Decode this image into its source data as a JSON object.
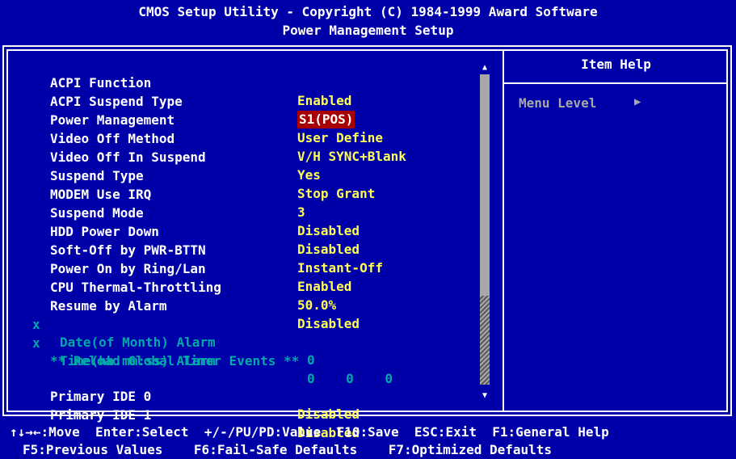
{
  "header": {
    "line1": "CMOS Setup Utility - Copyright (C) 1984-1999 Award Software",
    "line2": "Power Management Setup"
  },
  "settings": [
    {
      "label": "ACPI Function",
      "value": "Enabled"
    },
    {
      "label": "ACPI Suspend Type",
      "value": "S1(POS)"
    },
    {
      "label": "Power Management",
      "value": "User Define"
    },
    {
      "label": "Video Off Method",
      "value": "V/H SYNC+Blank"
    },
    {
      "label": "Video Off In Suspend",
      "value": "Yes"
    },
    {
      "label": "Suspend Type",
      "value": "Stop Grant"
    },
    {
      "label": "MODEM Use IRQ",
      "value": "3"
    },
    {
      "label": "Suspend Mode",
      "value": "Disabled"
    },
    {
      "label": "HDD Power Down",
      "value": "Disabled"
    },
    {
      "label": "Soft-Off by PWR-BTTN",
      "value": "Instant-Off"
    },
    {
      "label": "Power On by Ring/Lan",
      "value": "Enabled"
    },
    {
      "label": "CPU Thermal-Throttling",
      "value": "50.0%"
    },
    {
      "label": "Resume by Alarm",
      "value": "Disabled"
    },
    {
      "mark": "x",
      "label": "Date(of Month) Alarm",
      "value": "0"
    },
    {
      "mark": "x",
      "label": "Time(hh:mm:ss) Alarm",
      "value": "0    0    0"
    },
    {
      "section": "** Reload Global Timer Events **"
    },
    {
      "label": "Primary IDE 0",
      "value": "Disabled"
    },
    {
      "label": "Primary IDE 1",
      "value": "Disabled"
    }
  ],
  "scrollbar": {
    "up": "▲",
    "down": "▼"
  },
  "help": {
    "title": "Item Help",
    "menu_level": "Menu Level",
    "menu_arrow": "▶"
  },
  "footer": {
    "line1": "↑↓→←:Move  Enter:Select  +/-/PU/PD:Value  F10:Save  ESC:Exit  F1:General Help",
    "line2": "F5:Previous Values    F6:Fail-Safe Defaults    F7:Optimized Defaults"
  },
  "colors": {
    "background": "#0000a8",
    "value": "#ffff55",
    "highlight": "#a80000",
    "disabled": "#00a8a8"
  }
}
